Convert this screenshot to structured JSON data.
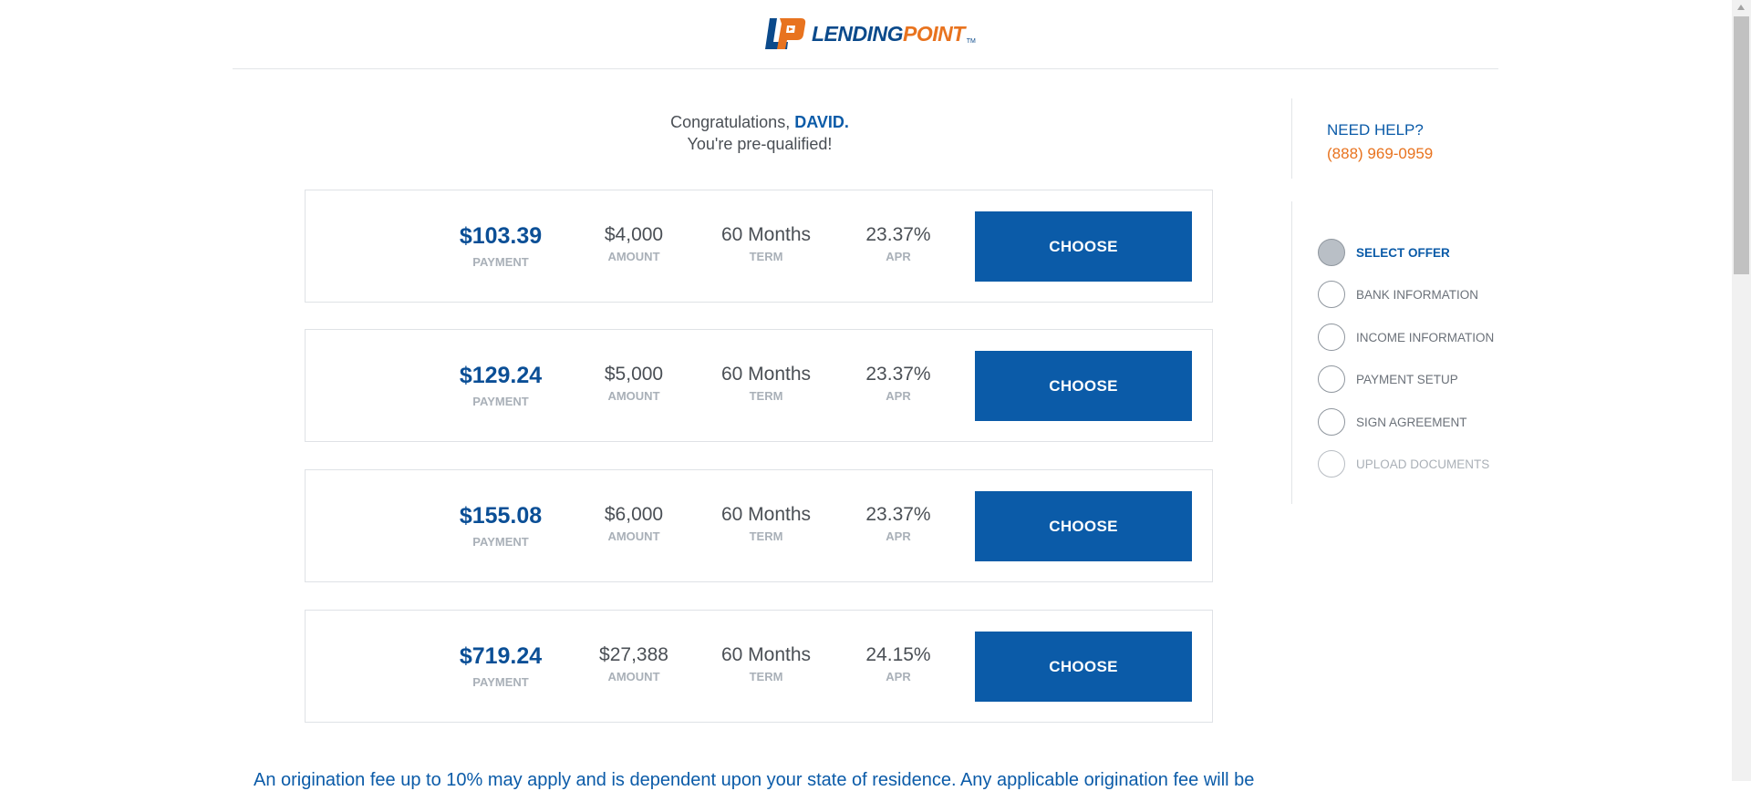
{
  "brand": {
    "name_part1": "LENDING",
    "name_part2": "POINT",
    "tm": "TM",
    "colors": {
      "primary": "#0b5ba8",
      "dark_blue": "#0b4f96",
      "orange": "#e8731f"
    }
  },
  "greeting": {
    "prefix": "Congratulations, ",
    "name": "DAVID.",
    "line2": "You're pre-qualified!"
  },
  "offers": [
    {
      "payment": "$103.39",
      "payment_label": "PAYMENT",
      "amount": "$4,000",
      "amount_label": "AMOUNT",
      "term": "60 Months",
      "term_label": "TERM",
      "apr": "23.37%",
      "apr_label": "APR",
      "button": "CHOOSE"
    },
    {
      "payment": "$129.24",
      "payment_label": "PAYMENT",
      "amount": "$5,000",
      "amount_label": "AMOUNT",
      "term": "60 Months",
      "term_label": "TERM",
      "apr": "23.37%",
      "apr_label": "APR",
      "button": "CHOOSE"
    },
    {
      "payment": "$155.08",
      "payment_label": "PAYMENT",
      "amount": "$6,000",
      "amount_label": "AMOUNT",
      "term": "60 Months",
      "term_label": "TERM",
      "apr": "23.37%",
      "apr_label": "APR",
      "button": "CHOOSE"
    },
    {
      "payment": "$719.24",
      "payment_label": "PAYMENT",
      "amount": "$27,388",
      "amount_label": "AMOUNT",
      "term": "60 Months",
      "term_label": "TERM",
      "apr": "24.15%",
      "apr_label": "APR",
      "button": "CHOOSE"
    }
  ],
  "help": {
    "title": "NEED HELP?",
    "phone": "(888) 969-0959"
  },
  "steps": [
    {
      "label": "SELECT OFFER",
      "state": "active"
    },
    {
      "label": "BANK INFORMATION",
      "state": "pending"
    },
    {
      "label": "INCOME INFORMATION",
      "state": "pending"
    },
    {
      "label": "PAYMENT SETUP",
      "state": "pending"
    },
    {
      "label": "SIGN AGREEMENT",
      "state": "pending"
    },
    {
      "label": "UPLOAD DOCUMENTS",
      "state": "disabled"
    }
  ],
  "disclaimer": "An origination fee up to 10% may apply and is dependent upon your state of residence. Any applicable origination fee will be"
}
